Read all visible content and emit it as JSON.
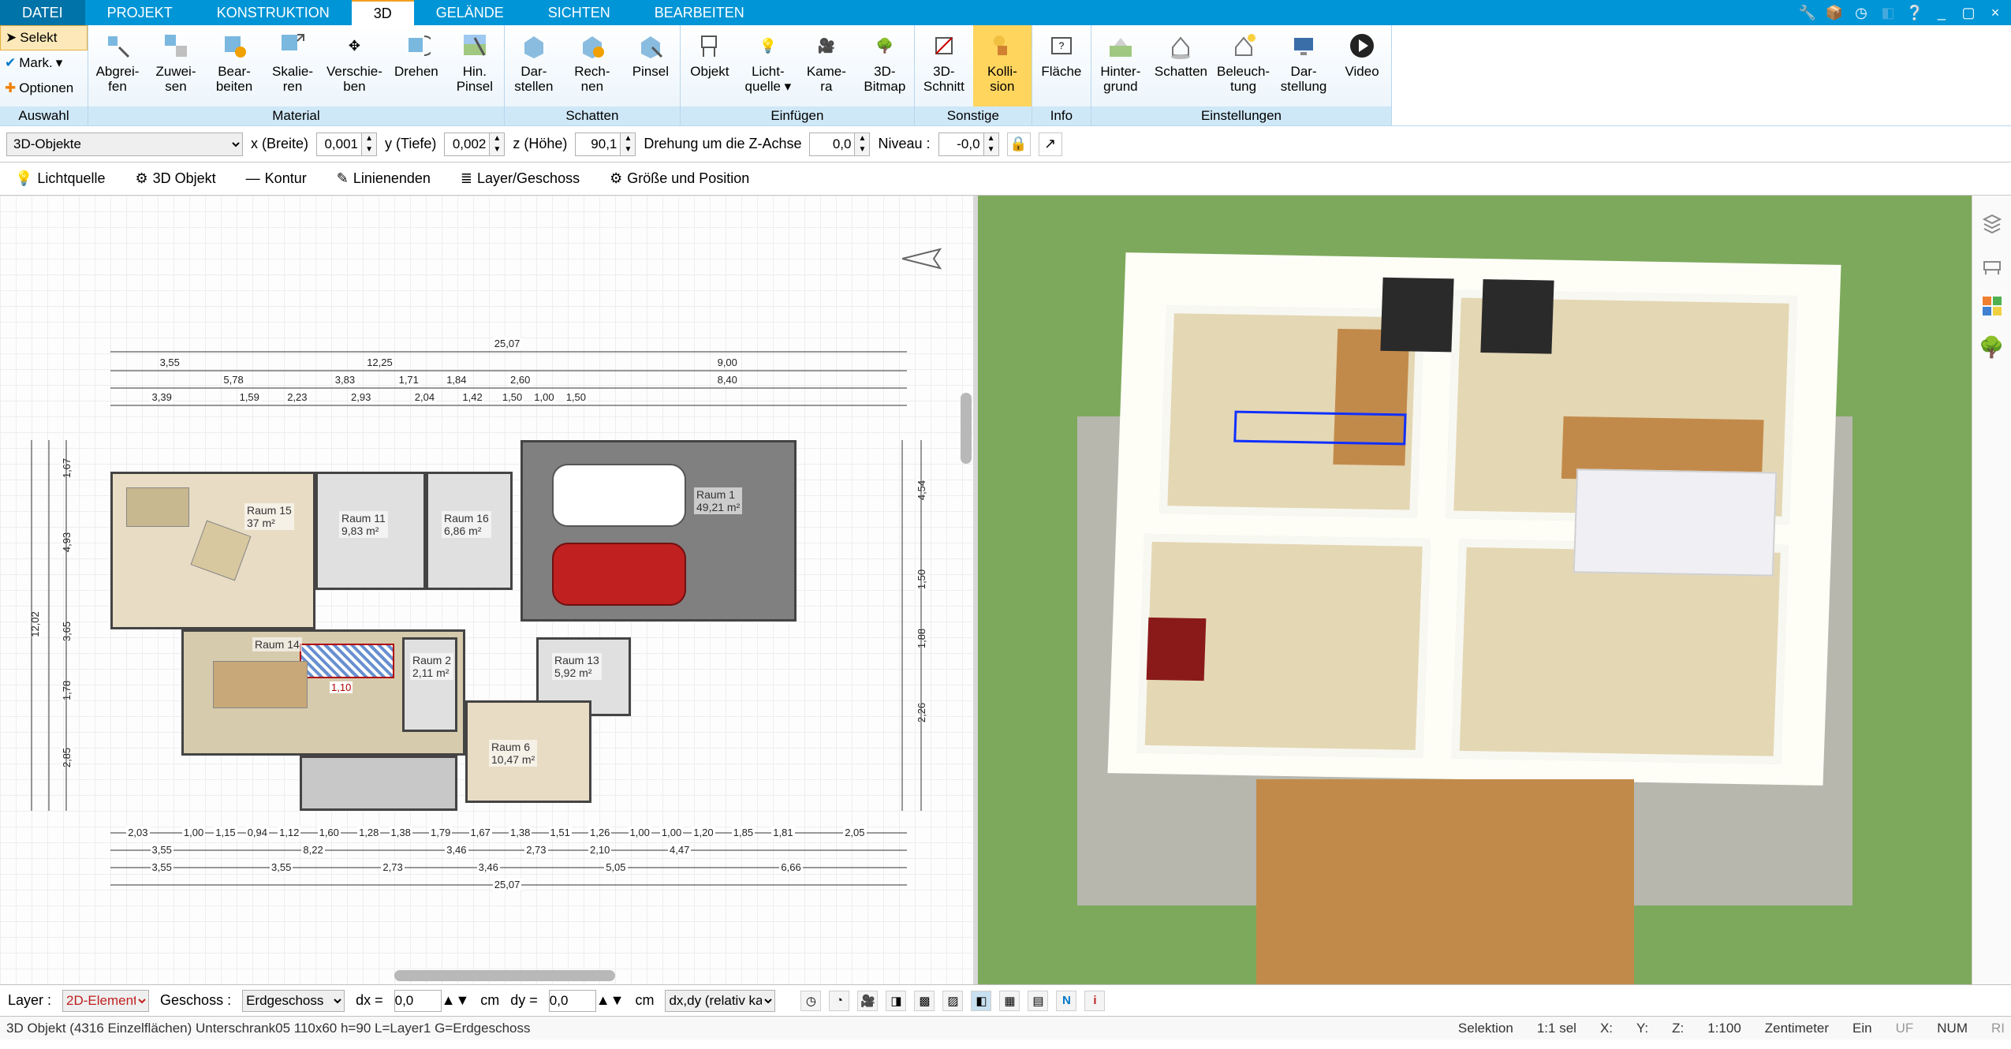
{
  "menu": {
    "tabs": [
      "DATEI",
      "PROJEKT",
      "KONSTRUKTION",
      "3D",
      "GELÄNDE",
      "SICHTEN",
      "BEARBEITEN"
    ],
    "active": "3D"
  },
  "auswahl": {
    "selekt": "Selekt",
    "mark": "Mark.",
    "optionen": "Optionen",
    "label": "Auswahl"
  },
  "ribbon": {
    "groups": [
      {
        "label": "Material",
        "items": [
          {
            "label": "Abgrei-\nfen"
          },
          {
            "label": "Zuwei-\nsen"
          },
          {
            "label": "Bear-\nbeiten"
          },
          {
            "label": "Skalie-\nren"
          },
          {
            "label": "Verschie-\nben"
          },
          {
            "label": "Drehen"
          },
          {
            "label": "Hin.\nPinsel"
          }
        ]
      },
      {
        "label": "Schatten",
        "items": [
          {
            "label": "Dar-\nstellen"
          },
          {
            "label": "Rech-\nnen"
          },
          {
            "label": "Pinsel"
          }
        ]
      },
      {
        "label": "Einfügen",
        "items": [
          {
            "label": "Objekt"
          },
          {
            "label": "Licht-\nquelle ▾"
          },
          {
            "label": "Kame-\nra"
          },
          {
            "label": "3D-\nBitmap"
          }
        ]
      },
      {
        "label": "Sonstige",
        "items": [
          {
            "label": "3D-\nSchnitt"
          },
          {
            "label": "Kolli-\nsion",
            "active": true
          }
        ]
      },
      {
        "label": "Info",
        "items": [
          {
            "label": "Fläche"
          }
        ]
      },
      {
        "label": "Einstellungen",
        "items": [
          {
            "label": "Hinter-\ngrund"
          },
          {
            "label": "Schatten"
          },
          {
            "label": "Beleuch-\ntung"
          },
          {
            "label": "Dar-\nstellung"
          },
          {
            "label": "Video"
          }
        ]
      }
    ]
  },
  "propbar": {
    "object_type": "3D-Objekte",
    "x_label": "x (Breite)",
    "x_val": "0,001",
    "y_label": "y (Tiefe)",
    "y_val": "0,002",
    "z_label": "z (Höhe)",
    "z_val": "90,1",
    "rot_label": "Drehung um die Z-Achse",
    "rot_val": "0,0",
    "niveau_label": "Niveau :",
    "niveau_val": "-0,0"
  },
  "toolbar2": {
    "licht": "Lichtquelle",
    "obj3d": "3D Objekt",
    "kontur": "Kontur",
    "linien": "Linienenden",
    "layer": "Layer/Geschoss",
    "pos": "Größe und Position"
  },
  "plan": {
    "rooms": [
      {
        "name": "Raum 15",
        "area": "37 m²"
      },
      {
        "name": "Raum 11",
        "area": "9,83 m²"
      },
      {
        "name": "Raum 16",
        "area": "6,86 m²"
      },
      {
        "name": "Raum 1",
        "area": "49,21 m²"
      },
      {
        "name": "Raum 14",
        "area": ""
      },
      {
        "name": "Raum 2",
        "area": "2,11 m²"
      },
      {
        "name": "Raum 13",
        "area": "5,92 m²"
      },
      {
        "name": "Raum 6",
        "area": "10,47 m²"
      }
    ],
    "dims_top": [
      "3,55",
      "12,25",
      "9,00",
      "5,78",
      "3,83",
      "1,71",
      "1,84",
      "2,60",
      "3,39",
      "1,59",
      "2,23",
      "2,93",
      "2,04",
      "1,42",
      "1,50",
      "1,00",
      "1,50",
      "8,40",
      "25,07"
    ],
    "dim_overall": "25,07",
    "dims_bot": [
      "2,03",
      "1,00",
      "1,15",
      "0,94",
      "1,12",
      "1,60",
      "1,28",
      "1,38",
      "1,79",
      "1,67",
      "1,38",
      "1,51",
      "1,26",
      "1,00",
      "1,00",
      "1,20",
      "1,85",
      "1,81",
      "2,05",
      "3,55",
      "8,22",
      "3,46",
      "2,73",
      "2,10",
      "4,47",
      "3,55",
      "3,55",
      "2,73",
      "3,46",
      "5,05",
      "6,66"
    ],
    "dims_left": [
      "1,67",
      "4,93",
      "3,65",
      "1,78",
      "2,85",
      "12,02"
    ],
    "dims_right": [
      "4,54",
      "1,50",
      "1,88",
      "2,26"
    ],
    "kitchen_dim": "1,10"
  },
  "bottbar": {
    "layer_label": "Layer :",
    "layer_val": "2D-Element",
    "geschoss_label": "Geschoss :",
    "geschoss_val": "Erdgeschoss",
    "dx_label": "dx =",
    "dx_val": "0,0",
    "dx_unit": "cm",
    "dy_label": "dy =",
    "dy_val": "0,0",
    "dy_unit": "cm",
    "dxdy": "dx,dy (relativ ka"
  },
  "status": {
    "left": "3D Objekt (4316 Einzelflächen) Unterschrank05   110x60   h=90 L=Layer1 G=Erdgeschoss",
    "sel": "Selektion",
    "sel2": "1:1 sel",
    "x": "X:",
    "y": "Y:",
    "z": "Z:",
    "scale": "1:100",
    "unit": "Zentimeter",
    "ein": "Ein",
    "uf": "UF",
    "num": "NUM",
    "ri": "RI"
  }
}
